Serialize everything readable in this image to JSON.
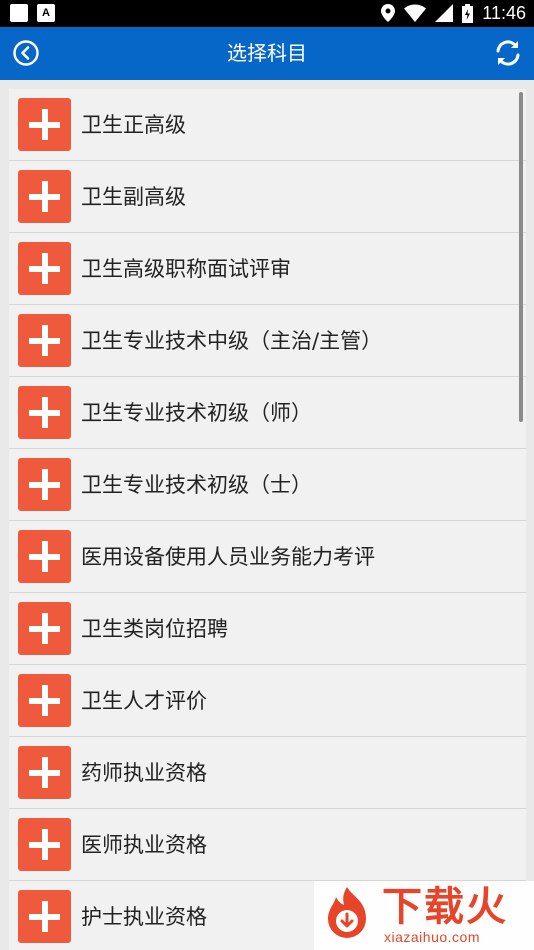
{
  "statusbar": {
    "time": "11:46",
    "notif_letter": "A"
  },
  "appbar": {
    "title": "选择科目"
  },
  "list": {
    "items": [
      {
        "label": "卫生正高级"
      },
      {
        "label": "卫生副高级"
      },
      {
        "label": "卫生高级职称面试评审"
      },
      {
        "label": "卫生专业技术中级（主治/主管）"
      },
      {
        "label": "卫生专业技术初级（师）"
      },
      {
        "label": "卫生专业技术初级（士）"
      },
      {
        "label": "医用设备使用人员业务能力考评"
      },
      {
        "label": "卫生类岗位招聘"
      },
      {
        "label": "卫生人才评价"
      },
      {
        "label": "药师执业资格"
      },
      {
        "label": "医师执业资格"
      },
      {
        "label": "护士执业资格"
      }
    ]
  },
  "watermark": {
    "brand": "下载火",
    "url": "xiazaihuo.com"
  },
  "colors": {
    "appbar": "#0767c9",
    "plus_button": "#f05a3c",
    "brand": "#e8442a"
  },
  "icons": {
    "back": "circle-chevron-left-icon",
    "refresh": "refresh-icon",
    "add": "plus-icon"
  }
}
